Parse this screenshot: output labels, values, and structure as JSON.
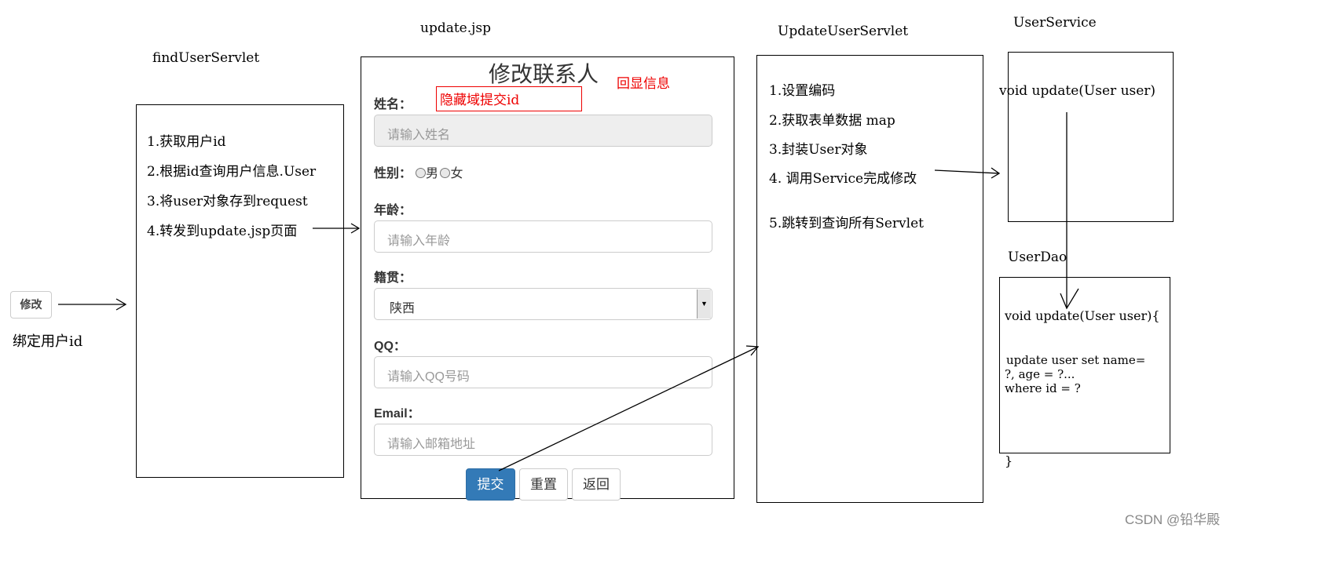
{
  "trigger": {
    "button_label": "修改",
    "caption": "绑定用户id"
  },
  "find_servlet": {
    "title": "findUserServlet",
    "steps": [
      "1.获取用户id",
      "2.根据id查询用户信息.User",
      "3.将user对象存到request",
      "4.转发到update.jsp页面"
    ]
  },
  "update_jsp": {
    "title": "update.jsp",
    "form_title": "修改联系人",
    "echo_note": "回显信息",
    "hidden_field_note": "隐藏域提交id",
    "fields": {
      "name_label": "姓名：",
      "name_placeholder": "请输入姓名",
      "gender_label": "性别：",
      "gender_male": "男",
      "gender_female": "女",
      "age_label": "年龄：",
      "age_placeholder": "请输入年龄",
      "native_label": "籍贯：",
      "native_selected": "陕西",
      "qq_label": "QQ：",
      "qq_placeholder": "请输入QQ号码",
      "email_label": "Email：",
      "email_placeholder": "请输入邮箱地址"
    },
    "buttons": {
      "submit": "提交",
      "reset": "重置",
      "back": "返回"
    }
  },
  "update_servlet": {
    "title": "UpdateUserServlet",
    "steps": [
      "1.设置编码",
      "2.获取表单数据 map",
      "3.封装User对象",
      "4. 调用Service完成修改",
      "5.跳转到查询所有Servlet"
    ]
  },
  "user_service": {
    "title": "UserService",
    "method": "void update(User user)"
  },
  "user_dao": {
    "title": "UserDao",
    "method": "void update(User user){",
    "sql_line1": "update user set name=",
    "sql_line2": "?, age = ?...",
    "sql_line3": "where id = ?",
    "closing": "}"
  },
  "watermark": "CSDN @铅华殿"
}
